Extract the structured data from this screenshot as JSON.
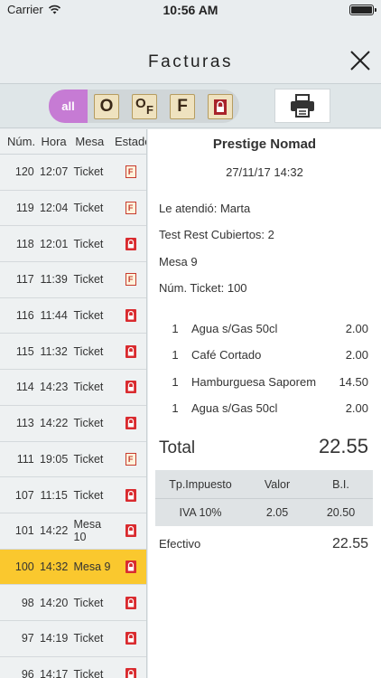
{
  "status_bar": {
    "carrier": "Carrier",
    "time": "10:56 AM"
  },
  "header": {
    "title": "Facturas"
  },
  "filters": {
    "all_label": "all",
    "options": [
      {
        "label": "O",
        "icon": "open-ticket-icon"
      },
      {
        "label": "OF",
        "icon": "open-invoice-icon"
      },
      {
        "label": "F",
        "icon": "invoice-icon"
      },
      {
        "label": "",
        "icon": "lock-icon"
      }
    ]
  },
  "list": {
    "headers": {
      "num": "Núm.",
      "hora": "Hora",
      "mesa": "Mesa",
      "estado": "Estado"
    },
    "rows": [
      {
        "num": "120",
        "hora": "12:07",
        "mesa": "Ticket",
        "estado": "F"
      },
      {
        "num": "119",
        "hora": "12:04",
        "mesa": "Ticket",
        "estado": "F"
      },
      {
        "num": "118",
        "hora": "12:01",
        "mesa": "Ticket",
        "estado": "lock"
      },
      {
        "num": "117",
        "hora": "11:39",
        "mesa": "Ticket",
        "estado": "F"
      },
      {
        "num": "116",
        "hora": "11:44",
        "mesa": "Ticket",
        "estado": "lock"
      },
      {
        "num": "115",
        "hora": "11:32",
        "mesa": "Ticket",
        "estado": "lock"
      },
      {
        "num": "114",
        "hora": "14:23",
        "mesa": "Ticket",
        "estado": "lock"
      },
      {
        "num": "113",
        "hora": "14:22",
        "mesa": "Ticket",
        "estado": "lock"
      },
      {
        "num": "111",
        "hora": "19:05",
        "mesa": "Ticket",
        "estado": "F"
      },
      {
        "num": "107",
        "hora": "11:15",
        "mesa": "Ticket",
        "estado": "lock"
      },
      {
        "num": "101",
        "hora": "14:22",
        "mesa": "Mesa 10",
        "estado": "lock"
      },
      {
        "num": "100",
        "hora": "14:32",
        "mesa": "Mesa 9",
        "estado": "lock",
        "selected": true
      },
      {
        "num": "98",
        "hora": "14:20",
        "mesa": "Ticket",
        "estado": "lock"
      },
      {
        "num": "97",
        "hora": "14:19",
        "mesa": "Ticket",
        "estado": "lock"
      },
      {
        "num": "96",
        "hora": "14:17",
        "mesa": "Ticket",
        "estado": "lock"
      }
    ]
  },
  "receipt": {
    "shop": "Prestige Nomad",
    "date": "27/11/17 14:32",
    "attended": "Le atendió: Marta",
    "cubiertos": "Test Rest Cubiertos: 2",
    "mesa": "Mesa 9",
    "ticket": "Núm. Ticket: 100",
    "items": [
      {
        "qty": "1",
        "desc": "Agua s/Gas 50cl",
        "price": "2.00"
      },
      {
        "qty": "1",
        "desc": "Café Cortado",
        "price": "2.00"
      },
      {
        "qty": "1",
        "desc": "Hamburguesa Saporem",
        "price": "14.50"
      },
      {
        "qty": "1",
        "desc": "Agua s/Gas 50cl",
        "price": "2.00"
      }
    ],
    "total_label": "Total",
    "total_value": "22.55",
    "tax": {
      "headers": [
        "Tp.Impuesto",
        "Valor",
        "B.I."
      ],
      "rows": [
        [
          "IVA 10%",
          "2.05",
          "20.50"
        ]
      ]
    },
    "payment_label": "Efectivo",
    "payment_value": "22.55"
  },
  "colors": {
    "selected_row": "#fac82e",
    "all_filter": "#c67bd4",
    "lock_red": "#d92b2f",
    "background": "#e9edef"
  }
}
